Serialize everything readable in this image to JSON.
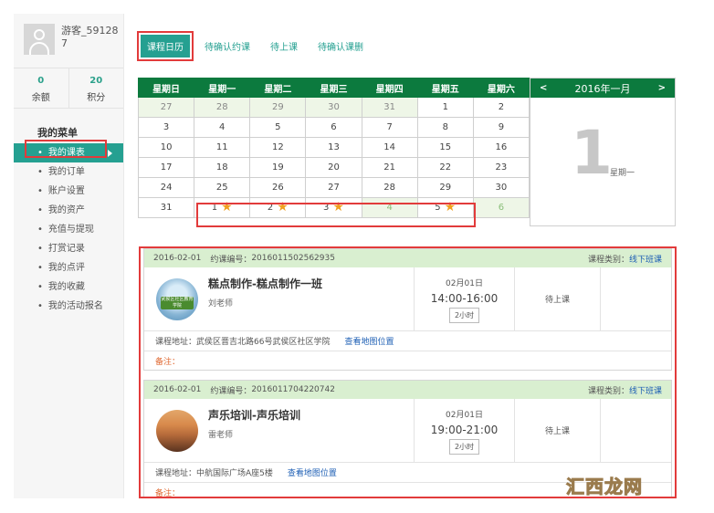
{
  "user": {
    "name": "游客_591287",
    "balance_value": "0",
    "balance_label": "余额",
    "points_value": "20",
    "points_label": "积分"
  },
  "menu": {
    "title": "我的菜单",
    "items": [
      {
        "label": "我的课表"
      },
      {
        "label": "我的订单"
      },
      {
        "label": "账户设置"
      },
      {
        "label": "我的资产"
      },
      {
        "label": "充值与提现"
      },
      {
        "label": "打赏记录"
      },
      {
        "label": "我的点评"
      },
      {
        "label": "我的收藏"
      },
      {
        "label": "我的活动报名"
      }
    ]
  },
  "tabs": [
    "课程日历",
    "待确认约课",
    "待上课",
    "待确认课删"
  ],
  "calendar": {
    "weekdays": [
      "星期日",
      "星期一",
      "星期二",
      "星期三",
      "星期四",
      "星期五",
      "星期六"
    ],
    "rows": [
      [
        "27",
        "28",
        "29",
        "30",
        "31",
        "1",
        "2"
      ],
      [
        "3",
        "4",
        "5",
        "6",
        "7",
        "8",
        "9"
      ],
      [
        "10",
        "11",
        "12",
        "13",
        "14",
        "15",
        "16"
      ],
      [
        "17",
        "18",
        "19",
        "20",
        "21",
        "22",
        "23"
      ],
      [
        "24",
        "25",
        "26",
        "27",
        "28",
        "29",
        "30"
      ],
      [
        "31",
        "1",
        "2",
        "3",
        "4",
        "5",
        "6"
      ]
    ],
    "prev": "<",
    "next": ">",
    "month_label": "2016年一月",
    "big_day": "1",
    "big_weekday": "星期一"
  },
  "lessons": [
    {
      "date": "2016-02-01",
      "order_label": "约课编号：",
      "order_no": "2016011502562935",
      "type_label": "课程类别：",
      "type_value": "线下班课",
      "course_name": "糕点制作-糕点制作一班",
      "teacher": "刘老师",
      "thumb_text": "武侯区社区教育学院",
      "day": "02月01日",
      "time": "14:00-16:00",
      "duration": "2小时",
      "status": "待上课",
      "address_label": "课程地址：",
      "address": "武侯区晋吉北路66号武侯区社区学院",
      "map_link": "查看地图位置",
      "note_label": "备注："
    },
    {
      "date": "2016-02-01",
      "order_label": "约课编号：",
      "order_no": "2016011704220742",
      "type_label": "课程类别：",
      "type_value": "线下班课",
      "course_name": "声乐培训-声乐培训",
      "teacher": "雷老师",
      "thumb_text": "",
      "day": "02月01日",
      "time": "19:00-21:00",
      "duration": "2小时",
      "status": "待上课",
      "address_label": "课程地址：",
      "address": "中航国际广场A座5楼",
      "map_link": "查看地图位置",
      "note_label": "备注："
    }
  ],
  "watermark": "汇西龙网",
  "colors": {
    "accent": "#25a091",
    "header_green": "#0c7a3e",
    "highlight": "#e23b3b",
    "link": "#1e5fb4",
    "pale_green": "#d9efd0"
  }
}
